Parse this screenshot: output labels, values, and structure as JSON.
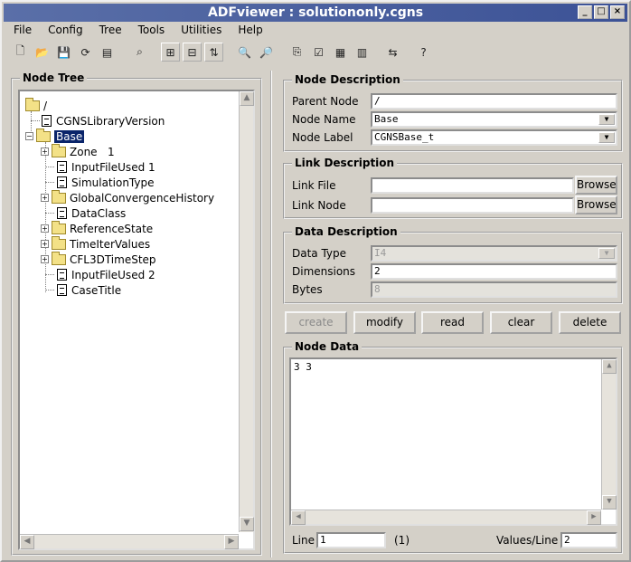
{
  "window": {
    "title": "ADFviewer : solutiononly.cgns",
    "controls": [
      "_",
      "□",
      "×"
    ]
  },
  "menu": [
    "File",
    "Config",
    "Tree",
    "Tools",
    "Utilities",
    "Help"
  ],
  "toolbar_icons": [
    "new-file-icon",
    "open-folder-icon",
    "save-icon",
    "refresh-icon",
    "properties-icon",
    "search-node-icon",
    "tree-expand-icon",
    "tree-collapse-icon",
    "tree-levels-icon",
    "find-icon",
    "find-next-icon",
    "copy-icon",
    "check-icon",
    "grid-icon",
    "list-icon",
    "link-icon",
    "help-icon"
  ],
  "node_tree": {
    "title": "Node Tree",
    "nodes": [
      {
        "label": "/"
      },
      {
        "label": "CGNSLibraryVersion"
      },
      {
        "label": "Base"
      },
      {
        "label": "Zone   1"
      },
      {
        "label": "InputFileUsed 1"
      },
      {
        "label": "SimulationType"
      },
      {
        "label": "GlobalConvergenceHistory"
      },
      {
        "label": "DataClass"
      },
      {
        "label": "ReferenceState"
      },
      {
        "label": "TimeIterValues"
      },
      {
        "label": "CFL3DTimeStep"
      },
      {
        "label": "InputFileUsed 2"
      },
      {
        "label": "CaseTitle"
      }
    ]
  },
  "node_description": {
    "title": "Node Description",
    "parent_node_label": "Parent Node",
    "parent_node_value": "/",
    "node_name_label": "Node Name",
    "node_name_value": "Base",
    "node_label_label": "Node Label",
    "node_label_value": "CGNSBase_t"
  },
  "link_description": {
    "title": "Link Description",
    "link_file_label": "Link File",
    "link_file_value": "",
    "link_node_label": "Link Node",
    "link_node_value": "",
    "browse": "Browse"
  },
  "data_description": {
    "title": "Data Description",
    "data_type_label": "Data Type",
    "data_type_value": "I4",
    "dimensions_label": "Dimensions",
    "dimensions_value": "2",
    "bytes_label": "Bytes",
    "bytes_value": "8"
  },
  "actions": {
    "create": "create",
    "modify": "modify",
    "read": "read",
    "clear": "clear",
    "delete": "delete"
  },
  "node_data": {
    "title": "Node Data",
    "content": "3 3",
    "line_label": "Line",
    "line_value": "1",
    "line_count": "(1)",
    "values_per_line_label": "Values/Line",
    "values_per_line_value": "2"
  }
}
